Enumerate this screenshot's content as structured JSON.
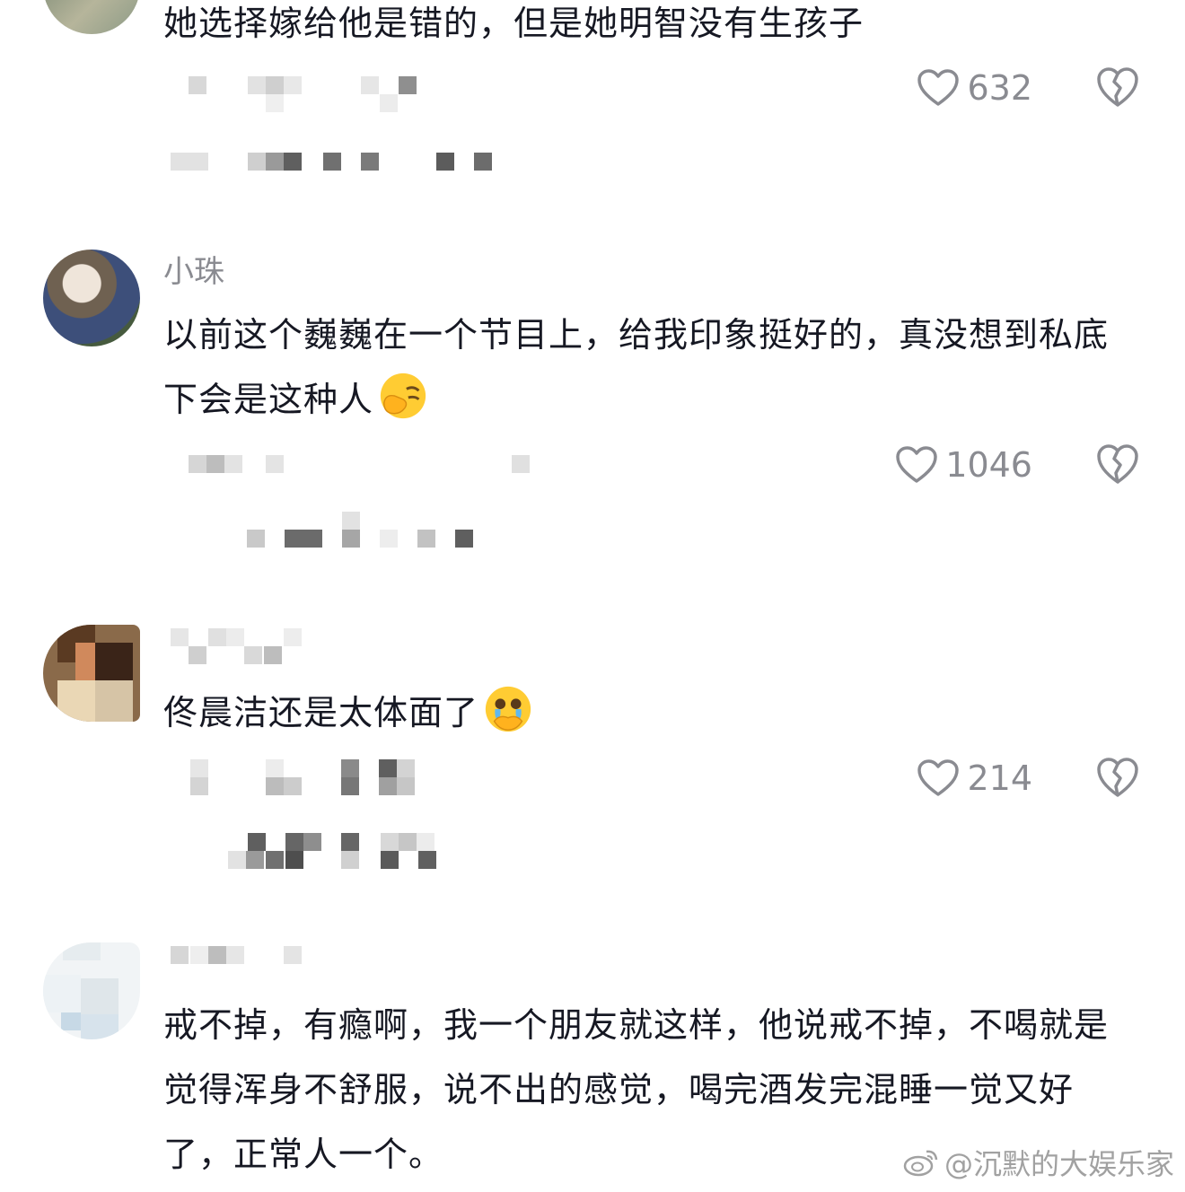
{
  "comments": [
    {
      "username": "",
      "text": "她选择嫁给他是错的，但是她明智没有生孩子",
      "likes": "632"
    },
    {
      "username": "小珠",
      "text": "以前这个巍巍在一个节目上，给我印象挺好的，真没想到私底下会是这种人",
      "emoji": "face-palm-emoji",
      "likes": "1046"
    },
    {
      "username": "",
      "text": "佟晨洁还是太体面了",
      "emoji": "crying-face-emoji",
      "likes": "214"
    },
    {
      "username": "",
      "text": "戒不掉，有瘾啊，我一个朋友就这样，他说戒不掉，不喝就是觉得浑身不舒服，说不出的感觉，喝完酒发完混睡一觉又好了，正常人一个。",
      "likes": ""
    }
  ],
  "icons": {
    "like": "heart-outline-icon",
    "dislike": "broken-heart-icon"
  },
  "watermark": "@沉默的大娱乐家",
  "colors": {
    "text": "#161823",
    "meta": "#8a8b91",
    "background": "#ffffff"
  }
}
